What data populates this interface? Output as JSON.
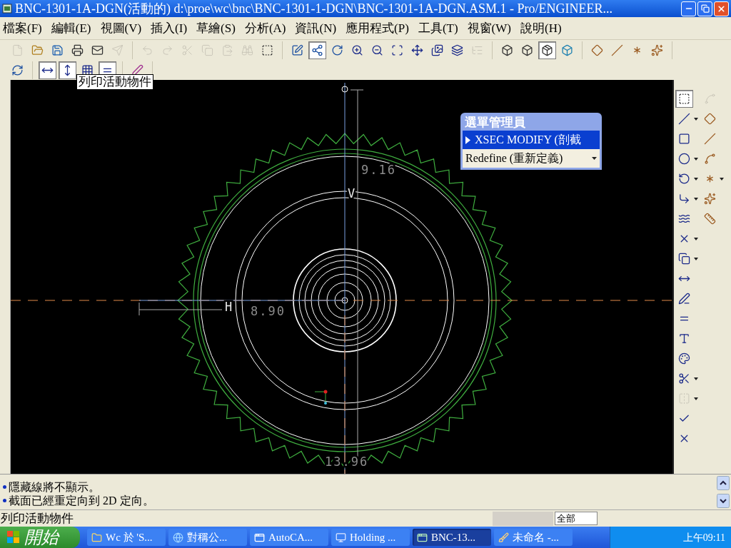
{
  "window": {
    "title": "BNC-1301-1A-DGN(活動的) d:\\proe\\wc\\bnc\\BNC-1301-1-DGN\\BNC-1301-1A-DGN.ASM.1 - Pro/ENGINEER..."
  },
  "menu": [
    "檔案(F)",
    "編輯(E)",
    "視圖(V)",
    "插入(I)",
    "草繪(S)",
    "分析(A)",
    "資訊(N)",
    "應用程式(P)",
    "工具(T)",
    "視窗(W)",
    "說明(H)"
  ],
  "toolbar_rows": [
    {
      "groups": [
        [
          {
            "kind": "new",
            "pressed": false,
            "disabled": true
          },
          {
            "kind": "open",
            "pressed": false,
            "disabled": false
          },
          {
            "kind": "save",
            "pressed": false,
            "disabled": false
          },
          {
            "kind": "print",
            "pressed": false,
            "disabled": false
          },
          {
            "kind": "mail",
            "pressed": false,
            "disabled": false
          },
          {
            "kind": "send",
            "pressed": false,
            "disabled": true
          }
        ],
        [
          {
            "kind": "undo",
            "pressed": false,
            "disabled": true
          },
          {
            "kind": "redo",
            "pressed": false,
            "disabled": true
          },
          {
            "kind": "cut",
            "pressed": false,
            "disabled": true
          },
          {
            "kind": "copy",
            "pressed": false,
            "disabled": true
          },
          {
            "kind": "paste",
            "pressed": false,
            "disabled": true
          },
          {
            "kind": "find",
            "pressed": false,
            "disabled": true
          },
          {
            "kind": "select",
            "pressed": false,
            "disabled": false
          }
        ],
        [
          {
            "kind": "repaint",
            "pressed": false,
            "disabled": false
          },
          {
            "kind": "datum",
            "pressed": true,
            "disabled": false
          },
          {
            "kind": "spin",
            "pressed": false,
            "disabled": false
          },
          {
            "kind": "zoom-in",
            "pressed": false,
            "disabled": false
          },
          {
            "kind": "zoom-out",
            "pressed": false,
            "disabled": false
          },
          {
            "kind": "zoom-fit",
            "pressed": false,
            "disabled": false
          },
          {
            "kind": "orient",
            "pressed": false,
            "disabled": false
          },
          {
            "kind": "views",
            "pressed": false,
            "disabled": false
          },
          {
            "kind": "layers",
            "pressed": false,
            "disabled": false
          },
          {
            "kind": "tree",
            "pressed": false,
            "disabled": true
          }
        ],
        [
          {
            "kind": "wireframe",
            "pressed": false,
            "disabled": false
          },
          {
            "kind": "hidden",
            "pressed": false,
            "disabled": false
          },
          {
            "kind": "no-hidden",
            "pressed": true,
            "disabled": false
          },
          {
            "kind": "shaded",
            "pressed": false,
            "disabled": false
          }
        ],
        [
          {
            "kind": "planes",
            "pressed": false,
            "disabled": false
          },
          {
            "kind": "axes",
            "pressed": false,
            "disabled": false
          },
          {
            "kind": "points",
            "pressed": false,
            "disabled": false
          },
          {
            "kind": "csys",
            "pressed": false,
            "disabled": false
          }
        ]
      ]
    },
    {
      "groups": [
        [
          {
            "kind": "regenerate",
            "pressed": false,
            "disabled": false
          }
        ],
        [
          {
            "kind": "dim-h",
            "pressed": true,
            "disabled": false
          },
          {
            "kind": "dim-v",
            "pressed": true,
            "disabled": false
          },
          {
            "kind": "grid",
            "pressed": false,
            "disabled": false
          },
          {
            "kind": "constraint",
            "pressed": true,
            "disabled": false
          }
        ],
        [
          {
            "kind": "sketch",
            "pressed": false,
            "disabled": false
          }
        ]
      ]
    }
  ],
  "tooltip": "列印活動物件",
  "canvas": {
    "labels": [
      {
        "kind": "dimension",
        "text": "9.16"
      },
      {
        "kind": "axis",
        "text": "V"
      },
      {
        "kind": "axis",
        "text": "H"
      },
      {
        "kind": "dimension",
        "text": "8.90"
      },
      {
        "kind": "dimension",
        "text": "13.96"
      }
    ]
  },
  "menu_manager": {
    "title": "選單管理員",
    "items": [
      {
        "label": "XSEC MODIFY (剖截",
        "selected": true,
        "dropdown": false
      },
      {
        "label": "Redefine (重新定義)",
        "selected": false,
        "dropdown": true
      }
    ]
  },
  "sketch_tools": {
    "columns": [
      [
        {
          "kind": "select",
          "pressed": true,
          "disabled": false,
          "menu": false
        },
        {
          "kind": "line",
          "pressed": false,
          "disabled": false,
          "menu": true
        },
        {
          "kind": "rectangle",
          "pressed": false,
          "disabled": false,
          "menu": false
        },
        {
          "kind": "circle",
          "pressed": false,
          "disabled": false,
          "menu": true
        },
        {
          "kind": "arc",
          "pressed": false,
          "disabled": false,
          "menu": true
        },
        {
          "kind": "fillet",
          "pressed": false,
          "disabled": false,
          "menu": true
        },
        {
          "kind": "spline",
          "pressed": false,
          "disabled": false,
          "menu": false
        },
        {
          "kind": "point",
          "pressed": false,
          "disabled": false,
          "menu": true
        },
        {
          "kind": "offset",
          "pressed": false,
          "disabled": false,
          "menu": true
        },
        {
          "kind": "dimension",
          "pressed": false,
          "disabled": false,
          "menu": false
        },
        {
          "kind": "modify",
          "pressed": false,
          "disabled": false,
          "menu": false
        },
        {
          "kind": "constraint",
          "pressed": false,
          "disabled": false,
          "menu": false
        },
        {
          "kind": "text",
          "pressed": false,
          "disabled": false,
          "menu": false
        },
        {
          "kind": "palette",
          "pressed": false,
          "disabled": false,
          "menu": false
        },
        {
          "kind": "trim",
          "pressed": false,
          "disabled": false,
          "menu": true
        },
        {
          "kind": "mirror",
          "pressed": false,
          "disabled": true,
          "menu": true
        },
        {
          "kind": "accept",
          "pressed": false,
          "disabled": false,
          "menu": false
        },
        {
          "kind": "cancel",
          "pressed": false,
          "disabled": false,
          "menu": false
        }
      ],
      [
        {
          "kind": "curve",
          "pressed": false,
          "disabled": true,
          "menu": false
        },
        {
          "kind": "plane",
          "pressed": false,
          "disabled": false,
          "menu": false
        },
        {
          "kind": "axis",
          "pressed": false,
          "disabled": false,
          "menu": false
        },
        {
          "kind": "wave",
          "pressed": false,
          "disabled": false,
          "menu": false
        },
        {
          "kind": "points",
          "pressed": false,
          "disabled": false,
          "menu": true
        },
        {
          "kind": "csys",
          "pressed": false,
          "disabled": false,
          "menu": false
        },
        {
          "kind": "ruler",
          "pressed": false,
          "disabled": false,
          "menu": false
        }
      ]
    ]
  },
  "messages": [
    "隱藏線將不顯示。",
    "截面已經重定向到 2D 定向。"
  ],
  "status_bar": {
    "text": "列印活動物件",
    "filter": "全部"
  },
  "taskbar": {
    "start": "開始",
    "tasks": [
      {
        "label": "Wc 於 'S...",
        "kind": "folder",
        "selected": false
      },
      {
        "label": "對稱公...",
        "kind": "browser",
        "selected": false
      },
      {
        "label": "AutoCA...",
        "kind": "cad",
        "selected": false
      },
      {
        "label": "Holding ...",
        "kind": "window",
        "selected": false
      },
      {
        "label": "BNC-13...",
        "kind": "proe",
        "selected": true
      },
      {
        "label": "未命名 -...",
        "kind": "paint",
        "selected": false
      }
    ],
    "clock": "上午09:11"
  }
}
